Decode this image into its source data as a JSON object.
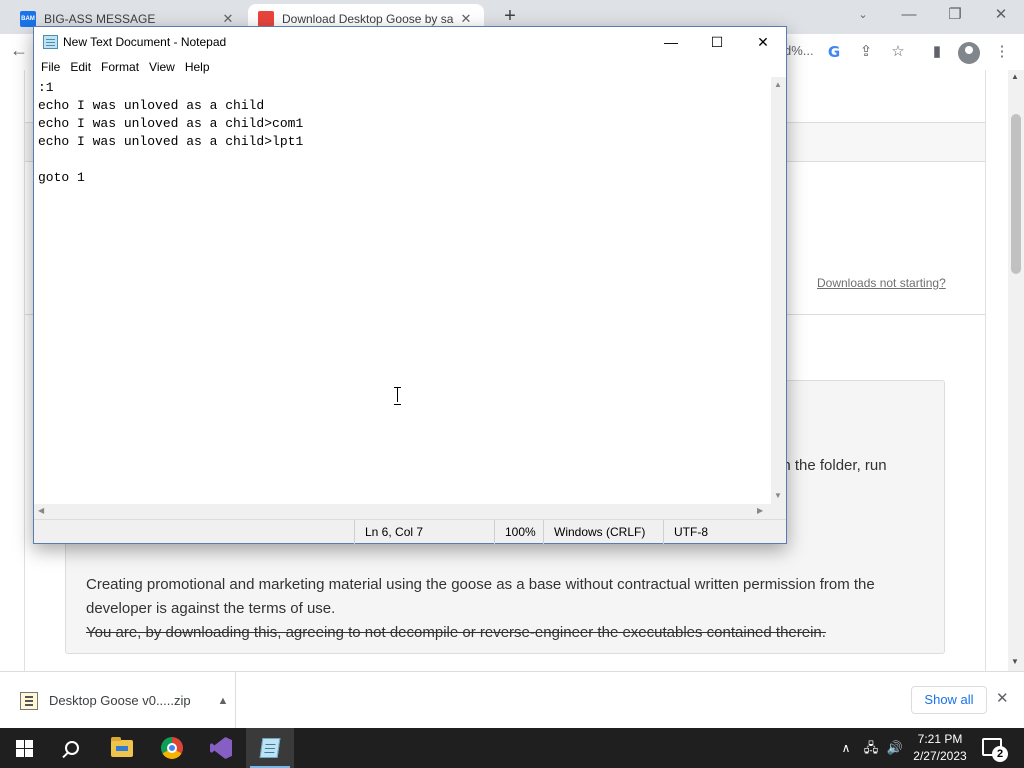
{
  "browser": {
    "tabs": [
      {
        "favicon": "BAM",
        "title": "BIG-ASS MESSAGE",
        "close": "✕"
      },
      {
        "favicon": "goose-favicon",
        "title": "Download Desktop Goose by sa",
        "close": "✕"
      }
    ],
    "new_tab": "+",
    "omnibox_fragment": "d%...",
    "window_controls": {
      "minimize": "—",
      "restore": "❐",
      "close": "✕"
    }
  },
  "page": {
    "downloads_link": "Downloads not starting?",
    "box_fragment": "en the folder, run",
    "terms_text": "Creating promotional and marketing material using the goose as a base without contractual written permission from the developer is against the terms of use.",
    "strike_text": "You are, by downloading this, agreeing to not decompile or reverse-engineer the executables contained therein."
  },
  "download_bar": {
    "file_name": "Desktop Goose v0.....zip",
    "show_all": "Show all",
    "close": "✕"
  },
  "notepad": {
    "title": "New Text Document - Notepad",
    "menu": [
      "File",
      "Edit",
      "Format",
      "View",
      "Help"
    ],
    "content": ":1\necho I was unloved as a child\necho I was unloved as a child>com1\necho I was unloved as a child>lpt1\n\ngoto 1",
    "status": {
      "position": "Ln 6, Col 7",
      "zoom": "100%",
      "line_ending": "Windows (CRLF)",
      "encoding": "UTF-8"
    }
  },
  "taskbar": {
    "apps": [
      "start",
      "search",
      "file-explorer",
      "chrome",
      "visual-studio",
      "notepad"
    ],
    "time": "7:21 PM",
    "date": "2/27/2023",
    "notification_count": "2"
  }
}
